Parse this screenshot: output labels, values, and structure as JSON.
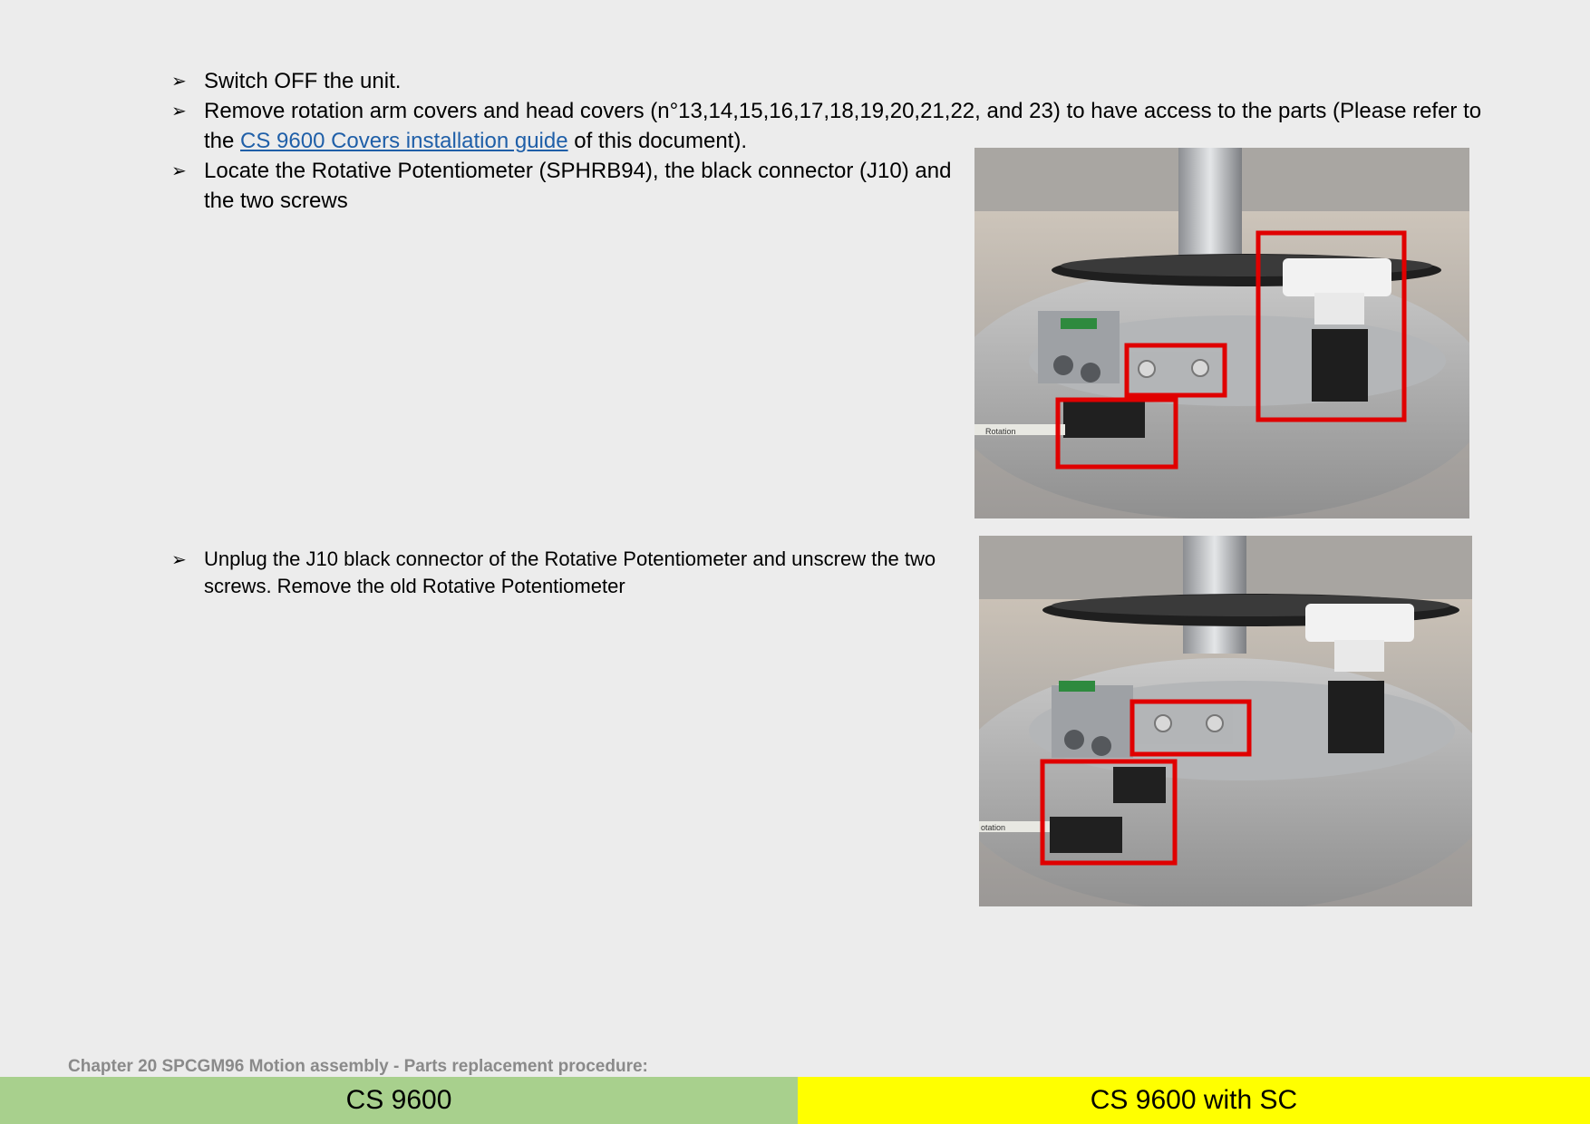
{
  "steps": [
    {
      "text": "Switch OFF the unit."
    },
    {
      "text_before": "Remove rotation arm covers and head covers (n°13,14,15,16,17,18,19,20,21,22, and 23) to have access to the parts (Please refer to the ",
      "link": "CS 9600 Covers installation guide",
      "text_after": " of this document)."
    },
    {
      "text": "Locate the Rotative Potentiometer (SPHRB94), the black connector (J10) and the two screws"
    },
    {
      "text": "Unplug the J10 black connector of the Rotative Potentiometer and unscrew the two screws. Remove the old Rotative Potentiometer"
    }
  ],
  "bullet_glyph": "➢",
  "photo1_label": "Rotation",
  "photo2_label": "otation",
  "footer": {
    "chapter": "Chapter 20 SPCGM96 Motion assembly - Parts replacement procedure:",
    "tab_left": "CS 9600",
    "tab_right": "CS 9600 with SC"
  },
  "colors": {
    "tab_left": "#a8d08d",
    "tab_right": "#ffff00",
    "highlight": "#e00000",
    "link": "#1f5fa8"
  }
}
